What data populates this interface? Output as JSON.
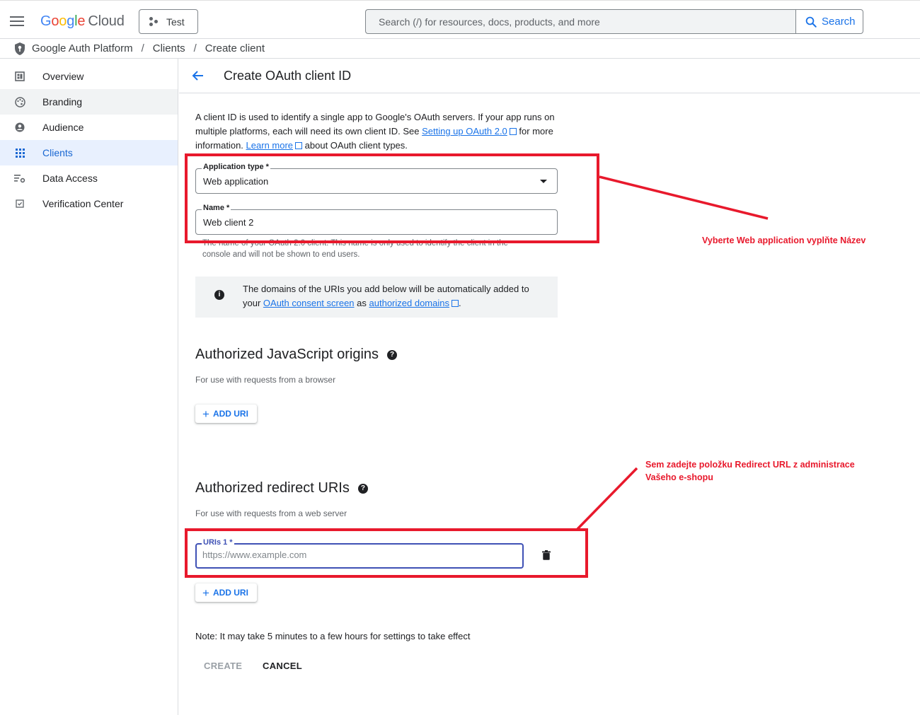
{
  "topbar": {
    "logo_google": "Google",
    "logo_cloud": "Cloud",
    "project_name": "Test",
    "search_placeholder": "Search (/) for resources, docs, products, and more",
    "search_button": "Search"
  },
  "breadcrumb": {
    "items": [
      "Google Auth Platform",
      "Clients",
      "Create client"
    ]
  },
  "sidebar": {
    "items": [
      {
        "label": "Overview",
        "icon": "dashboard-icon"
      },
      {
        "label": "Branding",
        "icon": "palette-icon"
      },
      {
        "label": "Audience",
        "icon": "account-circle-icon"
      },
      {
        "label": "Clients",
        "icon": "apps-grid-icon"
      },
      {
        "label": "Data Access",
        "icon": "data-access-icon"
      },
      {
        "label": "Verification Center",
        "icon": "verified-icon"
      }
    ]
  },
  "page": {
    "title": "Create OAuth client ID",
    "intro_1": "A client ID is used to identify a single app to Google's OAuth servers. If your app runs on multiple platforms, each will need its own client ID. See ",
    "intro_link1": "Setting up OAuth 2.0",
    "intro_2": " for more information. ",
    "intro_link2": "Learn more",
    "intro_3": " about OAuth client types."
  },
  "form": {
    "app_type_label": "Application type *",
    "app_type_value": "Web application",
    "name_label": "Name *",
    "name_value": "Web client 2",
    "name_hint": "The name of your OAuth 2.0 client. This name is only used to identify the client in the console and will not be shown to end users."
  },
  "info": {
    "text_1": "The domains of the URIs you add below will be automatically added to your ",
    "link1": "OAuth consent screen",
    "text_2": " as ",
    "link2": "authorized domains",
    "text_3": "."
  },
  "js_origins": {
    "title": "Authorized JavaScript origins",
    "subtitle": "For use with requests from a browser",
    "add_button": "ADD URI"
  },
  "redirect_uris": {
    "title": "Authorized redirect URIs",
    "subtitle": "For use with requests from a web server",
    "field_label": "URIs 1 *",
    "field_placeholder": "https://www.example.com",
    "add_button": "ADD URI"
  },
  "footer": {
    "note": "Note: It may take 5 minutes to a few hours for settings to take effect",
    "create": "CREATE",
    "cancel": "CANCEL"
  },
  "annotations": {
    "first": "Vyberte Web application vyplňte Název",
    "second_line1": "Sem zadejte položku Redirect URL z administrace",
    "second_line2": "Vašeho e-shopu",
    "color": "#e8192c"
  },
  "colors": {
    "accent": "#1a73e8",
    "active_nav_bg": "#e8f0fe",
    "focus_border": "#3f51b5"
  }
}
